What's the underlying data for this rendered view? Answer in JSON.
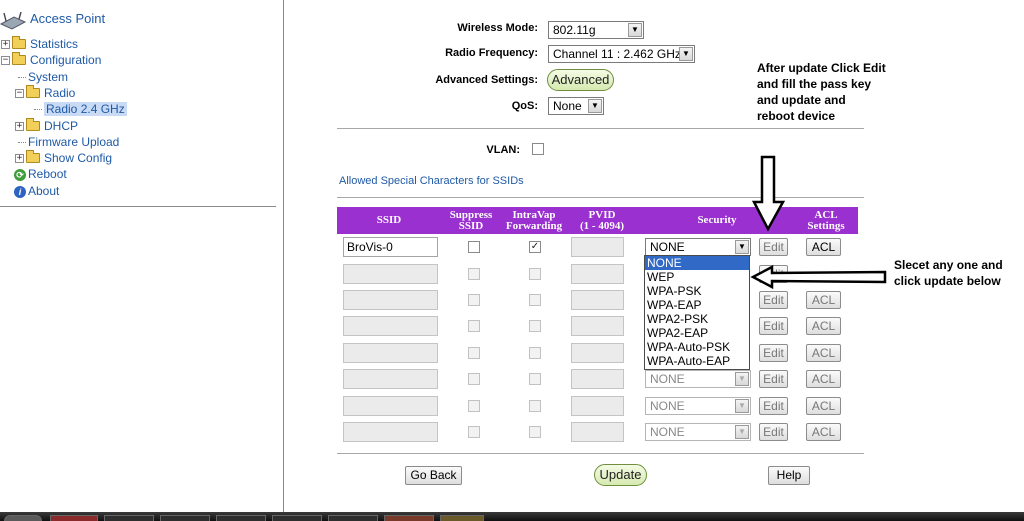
{
  "nav": {
    "root": "Access Point",
    "items": [
      {
        "label": "Statistics"
      },
      {
        "label": "Configuration"
      },
      {
        "label": "System"
      },
      {
        "label": "Radio"
      },
      {
        "label": "Radio 2.4 GHz"
      },
      {
        "label": "DHCP"
      },
      {
        "label": "Firmware Upload"
      },
      {
        "label": "Show Config"
      },
      {
        "label": "Reboot"
      },
      {
        "label": "About"
      }
    ]
  },
  "form": {
    "wireless_mode_label": "Wireless Mode:",
    "wireless_mode_value": "802.11g",
    "radio_frequency_label": "Radio Frequency:",
    "radio_frequency_value": "Channel 11 : 2.462 GHz",
    "advanced_settings_label": "Advanced Settings:",
    "advanced_button": "Advanced",
    "qos_label": "QoS:",
    "qos_value": "None",
    "vlan_label": "VLAN:",
    "allowed_chars_link": "Allowed Special Characters for SSIDs"
  },
  "table": {
    "headers": {
      "ssid": "SSID",
      "suppress_1": "Suppress",
      "suppress_2": "SSID",
      "intravap_1": "IntraVap",
      "intravap_2": "Forwarding",
      "pvid_1": "PVID",
      "pvid_2": "(1 - 4094)",
      "security": "Security",
      "acl_1": "ACL",
      "acl_2": "Settings"
    },
    "rows": [
      {
        "ssid": "BroVis-0",
        "security": "NONE"
      },
      {
        "ssid": "",
        "security": ""
      },
      {
        "ssid": "",
        "security": ""
      },
      {
        "ssid": "",
        "security": ""
      },
      {
        "ssid": "",
        "security": ""
      },
      {
        "ssid": "",
        "security": "NONE"
      },
      {
        "ssid": "",
        "security": "NONE"
      },
      {
        "ssid": "",
        "security": "NONE"
      }
    ],
    "edit_label": "Edit",
    "acl_label": "ACL"
  },
  "security_options": [
    "NONE",
    "WEP",
    "WPA-PSK",
    "WPA-EAP",
    "WPA2-PSK",
    "WPA2-EAP",
    "WPA-Auto-PSK",
    "WPA-Auto-EAP"
  ],
  "buttons": {
    "go_back": "Go Back",
    "update": "Update",
    "help": "Help"
  },
  "annotations": {
    "edit_note": [
      "After update Click Edit",
      "and fill the pass key",
      "and update and",
      "reboot device"
    ],
    "select_note": [
      "Slecet any one and",
      "click update below"
    ]
  },
  "colors": {
    "table_header": "#9b30d0",
    "link": "#1f5aa6",
    "selected_option": "#3169c6"
  }
}
